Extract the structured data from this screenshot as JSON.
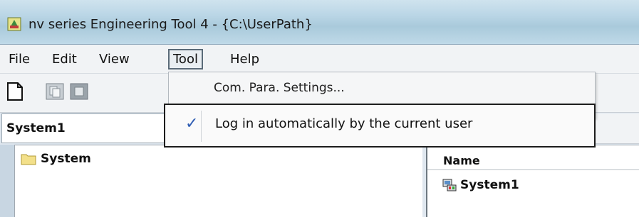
{
  "window": {
    "title": "nv series Engineering Tool 4 - {C:\\UserPath}"
  },
  "menu": {
    "items": [
      "File",
      "Edit",
      "View",
      "Tool",
      "Help"
    ]
  },
  "combo": {
    "value": "System1"
  },
  "tree": {
    "root": "System"
  },
  "list": {
    "header": "Name",
    "rows": [
      "System1"
    ]
  },
  "tool_menu": {
    "items": [
      {
        "label": "Com. Para. Settings..."
      },
      {
        "label": "Log in automatically by the current user",
        "checked": true
      }
    ]
  },
  "icons": {
    "check": "✓"
  }
}
